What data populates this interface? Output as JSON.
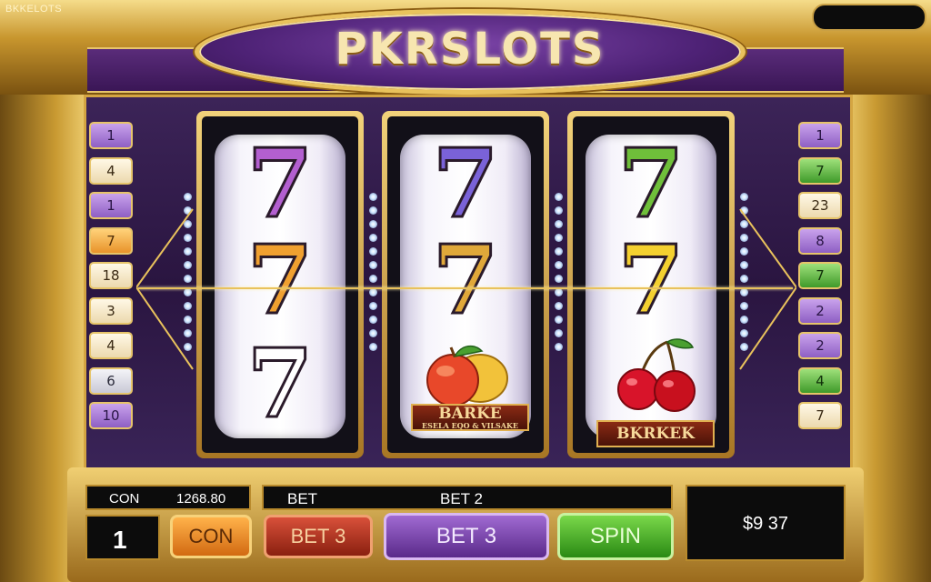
{
  "header": {
    "corner_brand": "BKKELOTS",
    "title": "PKRSLOTS"
  },
  "left_paylines": [
    "1",
    "4",
    "1",
    "7",
    "18",
    "3",
    "4",
    "6",
    "10"
  ],
  "right_paylines": [
    "1",
    "7",
    "23",
    "8",
    "7",
    "2",
    "2",
    "4",
    "7"
  ],
  "reels": [
    {
      "symbols": [
        "7",
        "7",
        "7"
      ]
    },
    {
      "symbols": [
        "7",
        "7"
      ],
      "label_main": "BARKE",
      "label_sub": "ESELA EQO & VILSAKE"
    },
    {
      "symbols": [
        "7",
        "7"
      ],
      "label_main": "BKRKEK"
    }
  ],
  "controls": {
    "credit_label": "CON",
    "credit_value": "1268.80",
    "bet_header_left": "BET",
    "bet_header_right": "BET 2",
    "line_value": "1",
    "con_button": "CON",
    "bet3_red_button": "BET 3",
    "bet3_purple_button": "BET 3",
    "spin_button": "SPIN",
    "win_amount": "$9 37"
  },
  "colors": {
    "gold": "#e9c25c",
    "purple": "#4e2276",
    "spin_green": "#3f9a2a"
  }
}
